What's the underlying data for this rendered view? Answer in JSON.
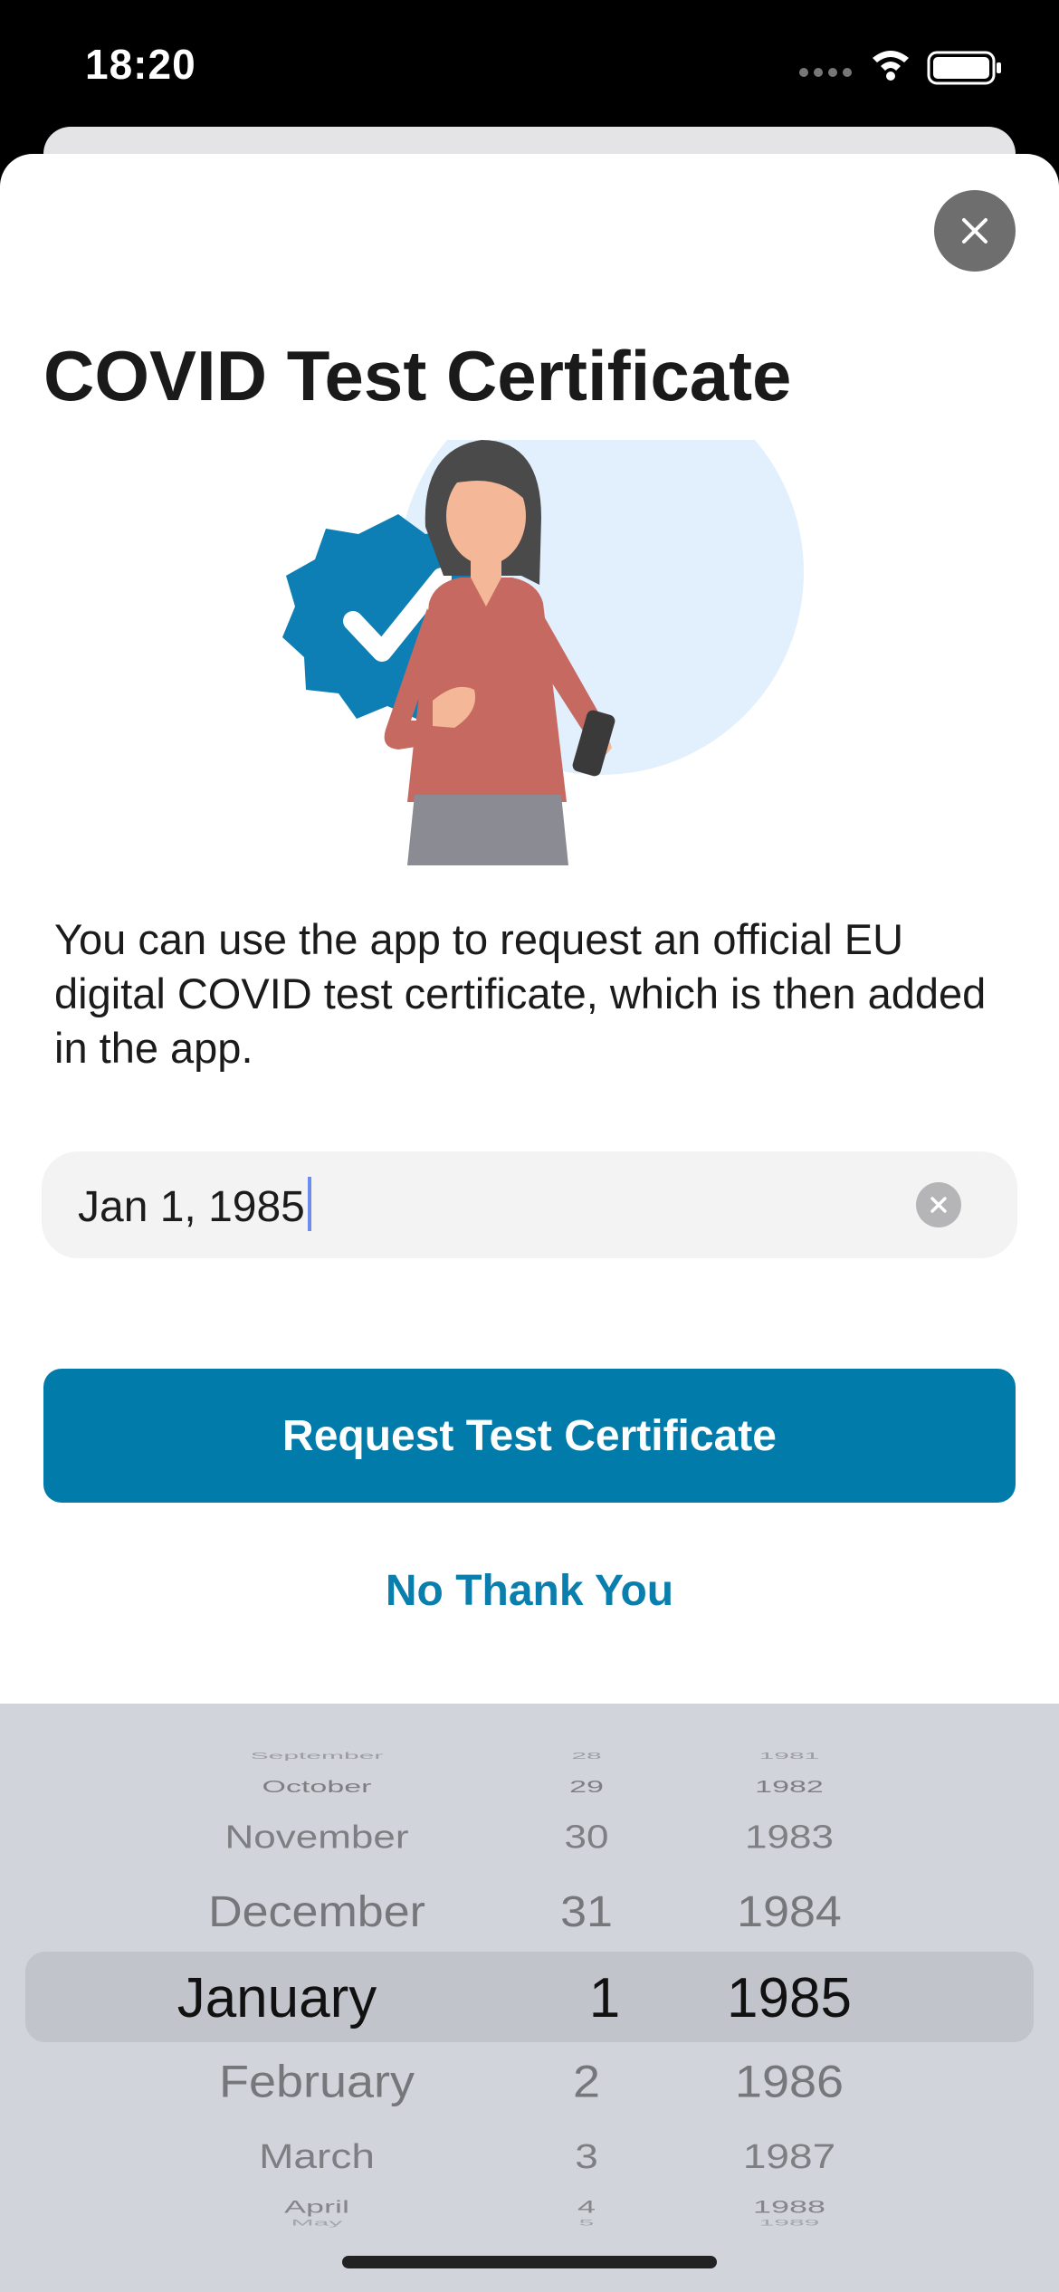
{
  "status_bar": {
    "time": "18:20"
  },
  "title": "COVID Test Certificate",
  "description": "You can use the app to request an official EU digital COVID test certificate, which is then added in the app.",
  "date_field": {
    "value": "Jan 1, 1985"
  },
  "buttons": {
    "request": "Request Test Certificate",
    "decline": "No Thank You"
  },
  "picker": {
    "months": [
      "September",
      "October",
      "November",
      "December",
      "January",
      "February",
      "March",
      "April",
      "May"
    ],
    "days": [
      "28",
      "29",
      "30",
      "31",
      "1",
      "2",
      "3",
      "4",
      "5"
    ],
    "years": [
      "1981",
      "1982",
      "1983",
      "1984",
      "1985",
      "1986",
      "1987",
      "1988",
      "1989"
    ],
    "selected_index": 4
  },
  "icons": {
    "close": "close-icon",
    "clear": "clear-icon",
    "wifi": "wifi-icon",
    "battery": "battery-icon",
    "signal": "signal-icon"
  },
  "colors": {
    "primary": "#007baa",
    "badge_blue": "#0d7fb5",
    "blouse": "#c66a61"
  }
}
